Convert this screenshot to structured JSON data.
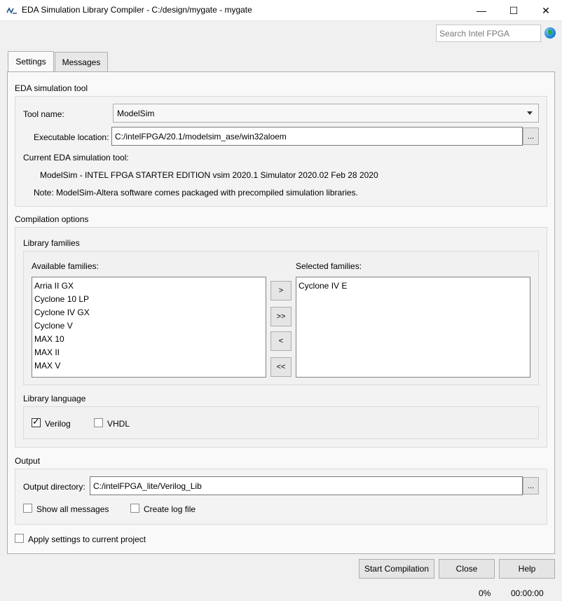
{
  "window": {
    "title": "EDA Simulation Library Compiler - C:/design/mygate - mygate",
    "minimize_glyph": "—",
    "maximize_glyph": "☐",
    "close_glyph": "✕"
  },
  "search": {
    "placeholder": "Search Intel FPGA",
    "icon": "globe-icon"
  },
  "tabs": [
    {
      "label": "Settings",
      "active": true
    },
    {
      "label": "Messages",
      "active": false
    }
  ],
  "eda_tool": {
    "section_title": "EDA simulation tool",
    "tool_name_label": "Tool name:",
    "tool_name_value": "ModelSim",
    "exe_label": "Executable location:",
    "exe_value": "C:/intelFPGA/20.1/modelsim_ase/win32aloem",
    "browse_label": "...",
    "current_label": "Current EDA simulation tool:",
    "current_value": "ModelSim - INTEL FPGA STARTER EDITION vsim 2020.1 Simulator 2020.02 Feb 28 2020",
    "note": "Note: ModelSim-Altera software comes packaged with precompiled simulation libraries."
  },
  "compilation": {
    "section_title": "Compilation options",
    "families_title": "Library families",
    "available_label": "Available families:",
    "available": [
      "Arria II GX",
      "Cyclone 10 LP",
      "Cyclone IV GX",
      "Cyclone V",
      "MAX 10",
      "MAX II",
      "MAX V"
    ],
    "selected_label": "Selected families:",
    "selected": [
      "Cyclone IV E"
    ],
    "move_buttons": {
      "add": ">",
      "add_all": ">>",
      "remove": "<",
      "remove_all": "<<"
    },
    "language_title": "Library language",
    "verilog_label": "Verilog",
    "verilog_checked": true,
    "vhdl_label": "VHDL",
    "vhdl_checked": false
  },
  "output": {
    "section_title": "Output",
    "dir_label": "Output directory:",
    "dir_value": "C:/intelFPGA_lite/Verilog_Lib",
    "browse_label": "...",
    "show_all_label": "Show all messages",
    "show_all_checked": false,
    "log_label": "Create log file",
    "log_checked": false
  },
  "apply_label": "Apply settings to current project",
  "apply_checked": false,
  "buttons": {
    "start": "Start Compilation",
    "close": "Close",
    "help": "Help"
  },
  "status": {
    "progress": "0%",
    "time": "00:00:00"
  }
}
